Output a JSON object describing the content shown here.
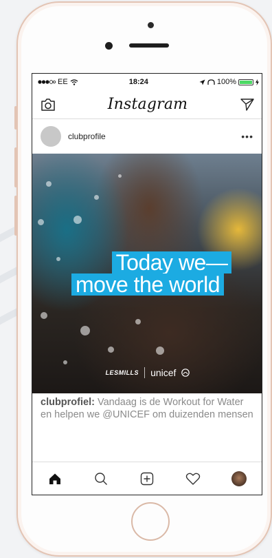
{
  "status": {
    "carrier": "EE",
    "time": "18:24",
    "battery": "100%"
  },
  "app": {
    "title": "Instagram"
  },
  "post": {
    "username": "clubprofile",
    "more": "•••",
    "headline_line1": "Today we—",
    "headline_line2": "move the world",
    "brand_left": "LESMILLS",
    "brand_right": "unicef",
    "caption_user": "clubprofiel:",
    "caption_text": " Vandaag is de Workout for Water en helpen we @UNICEF om duizenden mensen"
  },
  "icons": {
    "camera": "camera-icon",
    "direct": "direct-message-icon",
    "home": "home-icon",
    "search": "search-icon",
    "add": "add-post-icon",
    "heart": "heart-icon",
    "profile": "profile-avatar"
  },
  "colors": {
    "headline_bg": "#1cabe2",
    "battery": "#4cd964",
    "phone_trim": "#e3c4b4"
  }
}
